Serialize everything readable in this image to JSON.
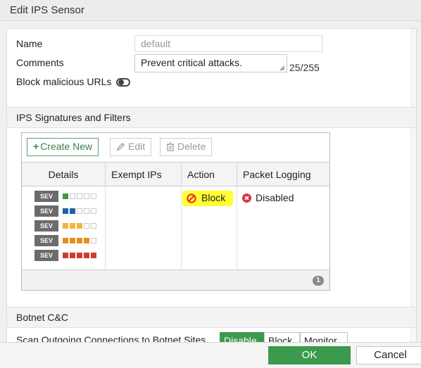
{
  "window": {
    "title": "Edit IPS Sensor"
  },
  "form": {
    "name_label": "Name",
    "name_placeholder": "default",
    "comments_label": "Comments",
    "comments_value": "Prevent critical attacks.",
    "char_counter": "25/255",
    "block_urls_label": "Block malicious URLs",
    "block_urls_enabled": false
  },
  "ips_section": {
    "title": "IPS Signatures and Filters",
    "toolbar": {
      "create_label": "Create New",
      "edit_label": "Edit",
      "delete_label": "Delete"
    },
    "columns": [
      "Details",
      "Exempt IPs",
      "Action",
      "Packet Logging"
    ],
    "row": {
      "severity_badge": "SEV",
      "severity_levels": [
        {
          "level": 1,
          "color": "#3e9a3e"
        },
        {
          "level": 2,
          "color": "#2361a8"
        },
        {
          "level": 3,
          "color": "#f2b43b"
        },
        {
          "level": 4,
          "color": "#e8901e"
        },
        {
          "level": 5,
          "color": "#d43a2f"
        }
      ],
      "exempt_ips": "",
      "action": "Block",
      "packet_logging": "Disabled"
    },
    "page": "1"
  },
  "botnet_section": {
    "title": "Botnet C&C",
    "scan_label": "Scan Outgoing Connections to Botnet Sites",
    "options": [
      "Disable",
      "Block",
      "Monitor"
    ],
    "selected": "Disable"
  },
  "footer": {
    "ok_label": "OK",
    "cancel_label": "Cancel"
  },
  "colors": {
    "accent_green": "#3c9a4f",
    "highlight": "#ffff33",
    "block_red": "#e8282b"
  }
}
